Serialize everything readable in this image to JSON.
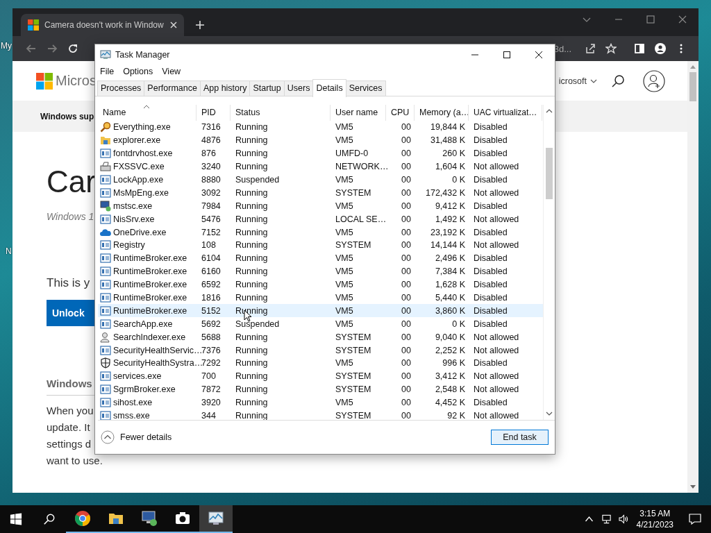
{
  "desktop_labels": [
    "My",
    "N"
  ],
  "browser": {
    "tab_title": "Camera doesn't work in Window",
    "address_fragment": "3d...",
    "page": {
      "brand": "Micros",
      "account_menu": "icrosoft",
      "nav_title": "Windows sup",
      "heading": "Car",
      "subtitle": "Windows 1",
      "prompt": "This is y",
      "button": "Unlock",
      "section_title": "Windows",
      "paragraph_lines": [
        "When you",
        "update. It",
        "settings d",
        "want to use."
      ]
    }
  },
  "task_manager": {
    "title": "Task Manager",
    "menu": [
      "File",
      "Options",
      "View"
    ],
    "tabs": [
      {
        "label": "Processes",
        "selected": false
      },
      {
        "label": "Performance",
        "selected": false
      },
      {
        "label": "App history",
        "selected": false
      },
      {
        "label": "Startup",
        "selected": false
      },
      {
        "label": "Users",
        "selected": false
      },
      {
        "label": "Details",
        "selected": true
      },
      {
        "label": "Services",
        "selected": false
      }
    ],
    "columns": [
      "Name",
      "PID",
      "Status",
      "User name",
      "CPU",
      "Memory (a…",
      "UAC virtualizat…"
    ],
    "rows": [
      {
        "kind": "search",
        "name": "Everything.exe",
        "pid": "7316",
        "status": "Running",
        "user": "VM5",
        "cpu": "00",
        "memory": "19,844 K",
        "uac": "Disabled",
        "hovered": false
      },
      {
        "kind": "folder",
        "name": "explorer.exe",
        "pid": "4876",
        "status": "Running",
        "user": "VM5",
        "cpu": "00",
        "memory": "31,488 K",
        "uac": "Disabled",
        "hovered": false
      },
      {
        "kind": "window",
        "name": "fontdrvhost.exe",
        "pid": "876",
        "status": "Running",
        "user": "UMFD-0",
        "cpu": "00",
        "memory": "260 K",
        "uac": "Disabled",
        "hovered": false
      },
      {
        "kind": "fax",
        "name": "FXSSVC.exe",
        "pid": "3240",
        "status": "Running",
        "user": "NETWORK…",
        "cpu": "00",
        "memory": "1,604 K",
        "uac": "Not allowed",
        "hovered": false
      },
      {
        "kind": "window",
        "name": "LockApp.exe",
        "pid": "8880",
        "status": "Suspended",
        "user": "VM5",
        "cpu": "00",
        "memory": "0 K",
        "uac": "Disabled",
        "hovered": false
      },
      {
        "kind": "window",
        "name": "MsMpEng.exe",
        "pid": "3092",
        "status": "Running",
        "user": "SYSTEM",
        "cpu": "00",
        "memory": "172,432 K",
        "uac": "Not allowed",
        "hovered": false
      },
      {
        "kind": "remote",
        "name": "mstsc.exe",
        "pid": "7984",
        "status": "Running",
        "user": "VM5",
        "cpu": "00",
        "memory": "9,412 K",
        "uac": "Disabled",
        "hovered": false
      },
      {
        "kind": "window",
        "name": "NisSrv.exe",
        "pid": "5476",
        "status": "Running",
        "user": "LOCAL SE…",
        "cpu": "00",
        "memory": "1,492 K",
        "uac": "Not allowed",
        "hovered": false
      },
      {
        "kind": "cloud",
        "name": "OneDrive.exe",
        "pid": "7152",
        "status": "Running",
        "user": "VM5",
        "cpu": "00",
        "memory": "23,192 K",
        "uac": "Disabled",
        "hovered": false
      },
      {
        "kind": "window",
        "name": "Registry",
        "pid": "108",
        "status": "Running",
        "user": "SYSTEM",
        "cpu": "00",
        "memory": "14,144 K",
        "uac": "Not allowed",
        "hovered": false
      },
      {
        "kind": "window",
        "name": "RuntimeBroker.exe",
        "pid": "6104",
        "status": "Running",
        "user": "VM5",
        "cpu": "00",
        "memory": "2,496 K",
        "uac": "Disabled",
        "hovered": false
      },
      {
        "kind": "window",
        "name": "RuntimeBroker.exe",
        "pid": "6160",
        "status": "Running",
        "user": "VM5",
        "cpu": "00",
        "memory": "7,384 K",
        "uac": "Disabled",
        "hovered": false
      },
      {
        "kind": "window",
        "name": "RuntimeBroker.exe",
        "pid": "6592",
        "status": "Running",
        "user": "VM5",
        "cpu": "00",
        "memory": "1,628 K",
        "uac": "Disabled",
        "hovered": false
      },
      {
        "kind": "window",
        "name": "RuntimeBroker.exe",
        "pid": "1816",
        "status": "Running",
        "user": "VM5",
        "cpu": "00",
        "memory": "5,440 K",
        "uac": "Disabled",
        "hovered": false
      },
      {
        "kind": "window",
        "name": "RuntimeBroker.exe",
        "pid": "5152",
        "status": "Running",
        "user": "VM5",
        "cpu": "00",
        "memory": "3,860 K",
        "uac": "Disabled",
        "hovered": true
      },
      {
        "kind": "window",
        "name": "SearchApp.exe",
        "pid": "5692",
        "status": "Suspended",
        "user": "VM5",
        "cpu": "00",
        "memory": "0 K",
        "uac": "Disabled",
        "hovered": false
      },
      {
        "kind": "indexer",
        "name": "SearchIndexer.exe",
        "pid": "5688",
        "status": "Running",
        "user": "SYSTEM",
        "cpu": "00",
        "memory": "9,040 K",
        "uac": "Not allowed",
        "hovered": false
      },
      {
        "kind": "window",
        "name": "SecurityHealthServic…",
        "pid": "7376",
        "status": "Running",
        "user": "SYSTEM",
        "cpu": "00",
        "memory": "2,252 K",
        "uac": "Not allowed",
        "hovered": false
      },
      {
        "kind": "shield",
        "name": "SecurityHealthSystra…",
        "pid": "7292",
        "status": "Running",
        "user": "VM5",
        "cpu": "00",
        "memory": "996 K",
        "uac": "Disabled",
        "hovered": false
      },
      {
        "kind": "window",
        "name": "services.exe",
        "pid": "700",
        "status": "Running",
        "user": "SYSTEM",
        "cpu": "00",
        "memory": "3,412 K",
        "uac": "Not allowed",
        "hovered": false
      },
      {
        "kind": "window",
        "name": "SgrmBroker.exe",
        "pid": "7872",
        "status": "Running",
        "user": "SYSTEM",
        "cpu": "00",
        "memory": "2,548 K",
        "uac": "Not allowed",
        "hovered": false
      },
      {
        "kind": "window",
        "name": "sihost.exe",
        "pid": "3920",
        "status": "Running",
        "user": "VM5",
        "cpu": "00",
        "memory": "4,452 K",
        "uac": "Disabled",
        "hovered": false
      },
      {
        "kind": "window",
        "name": "smss.exe",
        "pid": "344",
        "status": "Running",
        "user": "SYSTEM",
        "cpu": "00",
        "memory": "92 K",
        "uac": "Not allowed",
        "hovered": false
      }
    ],
    "fewer_details": "Fewer details",
    "end_task": "End task"
  },
  "taskbar": {
    "apps": [
      {
        "kind": "chrome",
        "selected": false
      },
      {
        "kind": "folder",
        "selected": false
      },
      {
        "kind": "remote",
        "selected": false
      },
      {
        "kind": "camera",
        "selected": false
      },
      {
        "kind": "taskmgr",
        "selected": true
      }
    ],
    "time": "3:15 AM",
    "date": "4/21/2023"
  }
}
